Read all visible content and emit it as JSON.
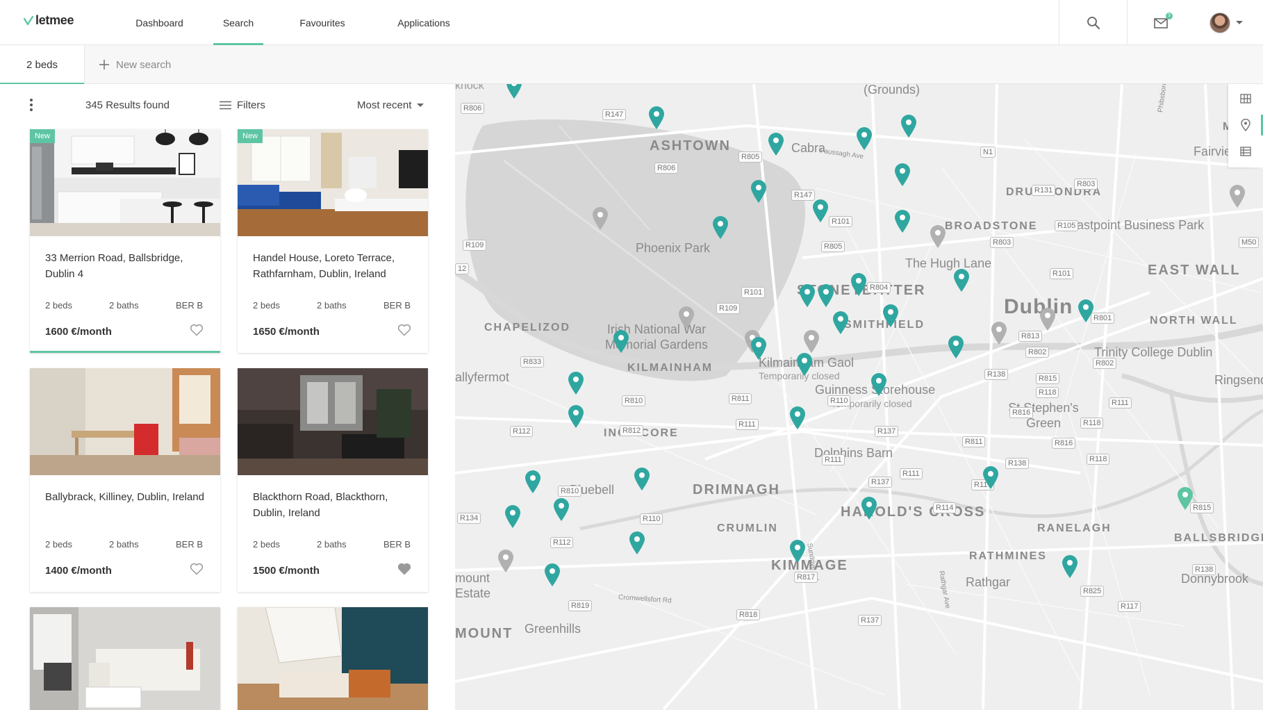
{
  "brand": {
    "name": "letmee",
    "accent": "#5ec5a4"
  },
  "nav": {
    "items": [
      {
        "label": "Dashboard"
      },
      {
        "label": "Search"
      },
      {
        "label": "Favourites"
      },
      {
        "label": "Applications"
      }
    ],
    "active": "Search",
    "icons": [
      "search-icon",
      "mail-icon",
      "avatar"
    ],
    "mail_count": "3"
  },
  "subbar": {
    "current_search": "2 beds",
    "new_search_label": "New search"
  },
  "list": {
    "results": "345 Results found",
    "filters_label": "Filters",
    "sort_label": "Most recent",
    "new_badge": "New",
    "listings": [
      {
        "address": "33 Merrion Road, Ballsbridge, Dublin 4",
        "beds": "2 beds",
        "baths": "2 baths",
        "ber": "BER B",
        "price": "1600 €/month",
        "is_new": true,
        "favourite": false,
        "selected": true
      },
      {
        "address": "Handel House, Loreto Terrace, Rathfarnham, Dublin, Ireland",
        "beds": "2 beds",
        "baths": "2 baths",
        "ber": "BER B",
        "price": "1650 €/month",
        "is_new": true,
        "favourite": false,
        "selected": false
      },
      {
        "address": "Ballybrack, Killiney, Dublin, Ireland",
        "beds": "2 beds",
        "baths": "2 baths",
        "ber": "BER B",
        "price": "1400 €/month",
        "is_new": false,
        "favourite": false,
        "selected": false
      },
      {
        "address": "Blackthorn Road, Blackthorn, Dublin, Ireland",
        "beds": "2 beds",
        "baths": "2 baths",
        "ber": "BER B",
        "price": "1500 €/month",
        "is_new": false,
        "favourite": true,
        "selected": false
      }
    ]
  },
  "map": {
    "labels": {
      "grounds": "(Grounds)",
      "ashtown": "ASHTOWN",
      "cabra": "Cabra",
      "drumcondra": "DRUMCONDRA",
      "mar": "MAR",
      "fairview": "Fairview",
      "broadstone": "BROADSTONE",
      "eastpoint": "Eastpoint Business Park",
      "phoenix_park": "Phoenix Park",
      "hugh_lane": "The Hugh Lane",
      "east_wall": "EAST WALL",
      "stoneybatter": "STONEYBATTER",
      "dublin": "Dublin",
      "north_wall": "NORTH WALL",
      "chapelizod": "CHAPELIZOD",
      "war_memorial": "Irish National War Memorial Gardens",
      "smithfield": "SMITHFIELD",
      "trinity": "Trinity College Dublin",
      "kilmainham": "KILMAINHAM",
      "kilmainham_gaol": "Kilmainham Gaol",
      "temp_closed_1": "Temporarily closed",
      "guinness": "Guinness Storehouse",
      "temp_closed_2": "Temporarily closed",
      "ringsend": "Ringsend",
      "ballyfermot": "allyfermot",
      "st_stephens": "St Stephen's Green",
      "inchicore": "INCHICORE",
      "dolphins_barn": "Dolphins Barn",
      "bluebell": "Bluebell",
      "drimnagh": "DRIMNAGH",
      "harolds_cross": "HAROLD'S CROSS",
      "ballsbridge": "BALLSBRIDGE",
      "crumlin": "CRUMLIN",
      "ranelagh": "RANELAGH",
      "rathmines": "RATHMINES",
      "kimmage": "KIMMAGE",
      "rathgar": "Rathgar",
      "donnybrook": "Donnybrook",
      "mount_estate": "mount Estate",
      "greenhills": "Greenhills",
      "mount": "MOUNT",
      "knock": "knock",
      "cromwellsfort": "Cromwellsfort Rd",
      "sundrive": "Sundrive Rd",
      "rathgar_ave": "Rathgar Ave",
      "phibsborough": "Phibsborough Ave",
      "faussagh": "Faussagh Ave"
    },
    "road_tags": [
      "R806",
      "R147",
      "R805",
      "R806",
      "R147",
      "R101",
      "R805",
      "R803",
      "R131",
      "R803",
      "R105",
      "R109",
      "R101",
      "R804",
      "R101",
      "R813",
      "R801",
      "R109",
      "R833",
      "R802",
      "R802",
      "R138",
      "R815",
      "R118",
      "R811",
      "R810",
      "R110",
      "R111",
      "R112",
      "R812",
      "R111",
      "R137",
      "R816",
      "R111",
      "R118",
      "R811",
      "R816",
      "R118",
      "R810",
      "R137",
      "R111",
      "R138",
      "R117",
      "R134",
      "R110",
      "R114",
      "R815",
      "R112",
      "R817",
      "R819",
      "R818",
      "R137",
      "R825",
      "R117",
      "R138",
      "N1",
      "M50",
      "12"
    ],
    "tools": [
      "grid-icon",
      "map-pin-icon",
      "list-icon"
    ]
  }
}
